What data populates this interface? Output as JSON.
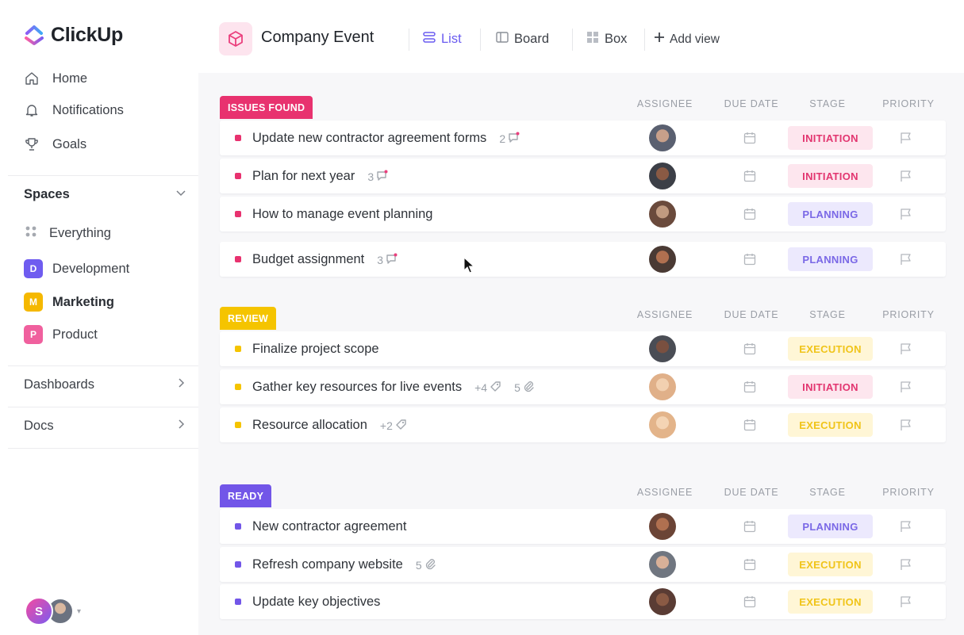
{
  "app": {
    "name": "ClickUp",
    "accent": "#7b5cf0"
  },
  "sidebar": {
    "nav": [
      {
        "label": "Home",
        "icon": "home-icon"
      },
      {
        "label": "Notifications",
        "icon": "bell-icon"
      },
      {
        "label": "Goals",
        "icon": "trophy-icon"
      }
    ],
    "spaces_label": "Spaces",
    "spaces": [
      {
        "label": "Everything",
        "icon": "grid-icon"
      },
      {
        "label": "Development",
        "badge": "D",
        "color": "#6f5cf0"
      },
      {
        "label": "Marketing",
        "badge": "M",
        "color": "#f5b800"
      },
      {
        "label": "Product",
        "badge": "P",
        "color": "#f0609e"
      }
    ],
    "dashboards_label": "Dashboards",
    "docs_label": "Docs",
    "user_initial": "S"
  },
  "header": {
    "title": "Company Event",
    "views": [
      {
        "label": "List",
        "icon": "list-icon",
        "active": true
      },
      {
        "label": "Board",
        "icon": "board-icon",
        "active": false
      },
      {
        "label": "Box",
        "icon": "box-icon",
        "active": false
      }
    ],
    "add_view_label": "Add view"
  },
  "columns": [
    "ASSIGNEE",
    "DUE DATE",
    "STAGE",
    "PRIORITY"
  ],
  "groups": [
    {
      "label": "ISSUES FOUND",
      "color": "#e8326f",
      "tasks": [
        {
          "name": "Update new contractor agreement forms",
          "meta": [
            {
              "text": "2",
              "icon": "comment-icon"
            }
          ],
          "stage": "INITIATION"
        },
        {
          "name": "Plan for next year",
          "meta": [
            {
              "text": "3",
              "icon": "comment-icon"
            }
          ],
          "stage": "INITIATION"
        },
        {
          "name": "How to manage event planning",
          "meta": [],
          "stage": "PLANNING"
        },
        {
          "name": "Budget assignment",
          "meta": [
            {
              "text": "3",
              "icon": "comment-icon"
            }
          ],
          "stage": "PLANNING"
        }
      ]
    },
    {
      "label": "REVIEW",
      "color": "#f5c400",
      "tasks": [
        {
          "name": "Finalize project scope",
          "meta": [],
          "stage": "EXECUTION"
        },
        {
          "name": "Gather key resources for live events",
          "meta": [
            {
              "text": "+4",
              "icon": "tag-icon"
            },
            {
              "text": "5",
              "icon": "paperclip-icon"
            }
          ],
          "stage": "INITIATION"
        },
        {
          "name": "Resource allocation",
          "meta": [
            {
              "text": "+2",
              "icon": "tag-icon"
            }
          ],
          "stage": "EXECUTION"
        }
      ]
    },
    {
      "label": "READY",
      "color": "#7256e8",
      "tasks": [
        {
          "name": "New contractor agreement",
          "meta": [],
          "stage": "PLANNING"
        },
        {
          "name": "Refresh company website",
          "meta": [
            {
              "text": "5",
              "icon": "paperclip-icon"
            }
          ],
          "stage": "EXECUTION"
        },
        {
          "name": "Update key objectives",
          "meta": [],
          "stage": "EXECUTION"
        }
      ]
    }
  ],
  "stage_colors": {
    "INITIATION": {
      "bg": "#fde6ee",
      "fg": "#e23670"
    },
    "PLANNING": {
      "bg": "#ece9fd",
      "fg": "#7a68e6"
    },
    "EXECUTION": {
      "bg": "#fff6d6",
      "fg": "#f0c419"
    }
  }
}
